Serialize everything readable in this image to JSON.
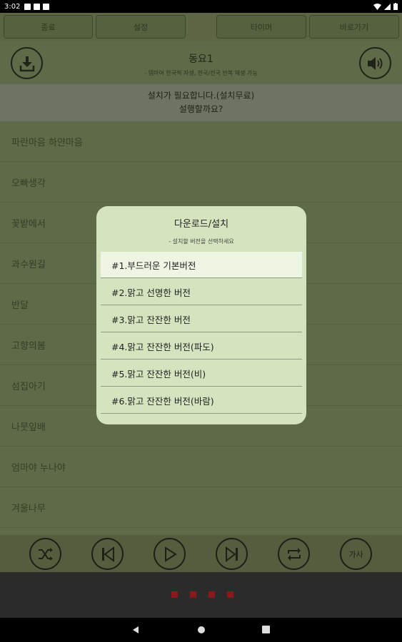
{
  "status_bar": {
    "time": "3:02"
  },
  "top_buttons": [
    "종료",
    "설정",
    "타이머",
    "바로가기"
  ],
  "header": {
    "title": "동요1",
    "subtitle": "- 템마여 한국씩 자생, 한국/전국 반복 재생 가능",
    "download_icon": "download-icon",
    "volume_icon": "speaker-icon"
  },
  "banner": {
    "line1": "설치가 필요합니다.(설치무료)",
    "line2": "설행할까요?"
  },
  "songs": [
    "파란마음 하얀마음",
    "오빠생각",
    "꽃밭에서",
    "과수원길",
    "반달",
    "고향의봄",
    "섬집아기",
    "나뭇잎배",
    "엄마야 누나야",
    "겨울나무"
  ],
  "controls": {
    "shuffle_icon": "shuffle-icon",
    "prev_icon": "skip-previous-icon",
    "play_icon": "play-icon",
    "next_icon": "skip-next-icon",
    "repeat_icon": "repeat-icon",
    "lyrics_label": "가사"
  },
  "dialog": {
    "title": "다운로드/설치",
    "subtitle": "- 설치할 버전을 선택하세요",
    "options": [
      "#1.부드러운 기본버전",
      "#2.맑고 선명한 버전",
      "#3.맑고 잔잔한 버전",
      "#4.맑고 잔잔한 버전(파도)",
      "#5.맑고 잔잔한 버전(비)",
      "#6.맑고 잔잔한 버전(바람)"
    ],
    "selected_index": 0
  },
  "colors": {
    "app_bg": "#5f6a48",
    "dialog_bg": "#d5e4bf",
    "selected_option": "#eef6e3",
    "player_indicator": "#8a1a1a"
  }
}
